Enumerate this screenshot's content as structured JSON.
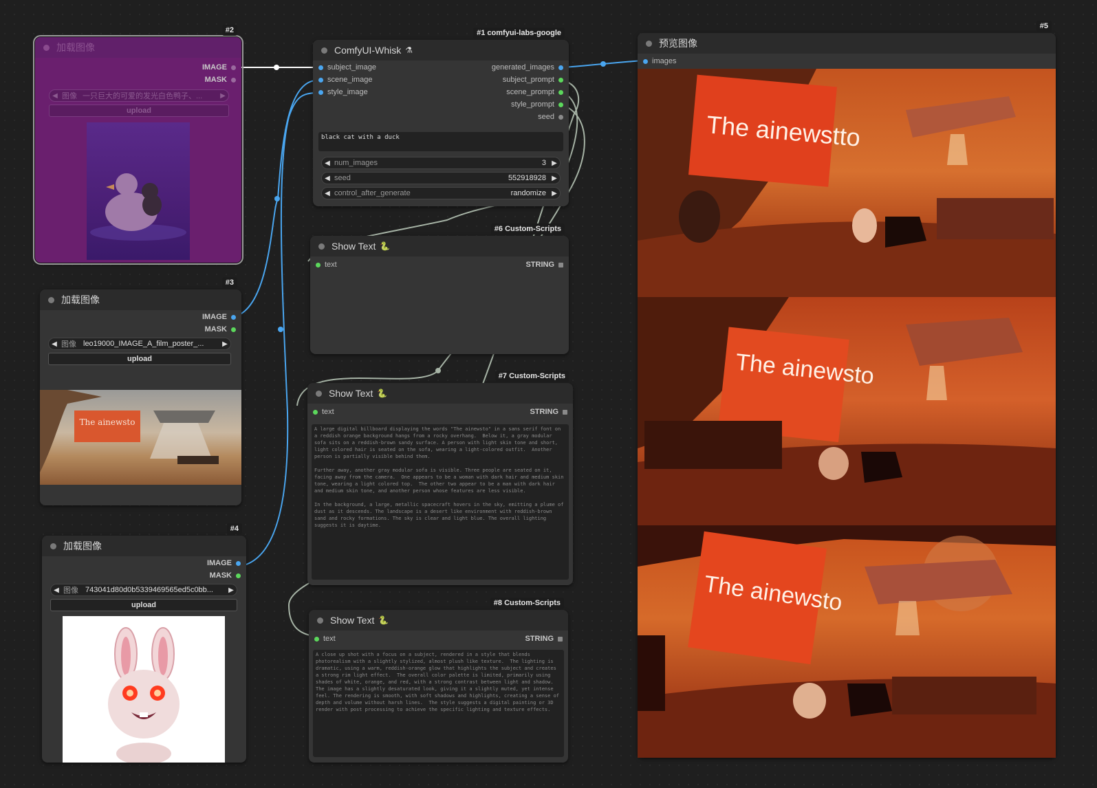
{
  "nodes": {
    "n1": {
      "badge": "#1 comfyui-labs-google",
      "title": "ComfyUI-Whisk",
      "title_icon": "flask-icon",
      "inputs": [
        "subject_image",
        "scene_image",
        "style_image"
      ],
      "outputs": [
        "generated_images",
        "subject_prompt",
        "scene_prompt",
        "style_prompt",
        "seed"
      ],
      "prompt_text": "black cat with a duck",
      "widgets": [
        {
          "label": "num_images",
          "value": "3"
        },
        {
          "label": "seed",
          "value": "552918928"
        },
        {
          "label": "control_after_generate",
          "value": "randomize"
        }
      ]
    },
    "n2": {
      "badge": "#2",
      "title": "加载图像",
      "outputs": [
        "IMAGE",
        "MASK"
      ],
      "image_widget": {
        "label": "图像",
        "value": "一只巨大的可爱的发光白色鸭子、..."
      },
      "upload_label": "upload"
    },
    "n3": {
      "badge": "#3",
      "title": "加载图像",
      "outputs": [
        "IMAGE",
        "MASK"
      ],
      "image_widget": {
        "label": "图像",
        "value": "leo19000_IMAGE_A_film_poster_..."
      },
      "upload_label": "upload",
      "preview_sign_text": "The ainewsto"
    },
    "n4": {
      "badge": "#4",
      "title": "加载图像",
      "outputs": [
        "IMAGE",
        "MASK"
      ],
      "image_widget": {
        "label": "图像",
        "value": "743041d80d0b5339469565ed5c0bb..."
      },
      "upload_label": "upload"
    },
    "n5": {
      "badge": "#5",
      "title": "预览图像",
      "inputs": [
        "images"
      ],
      "billboards": [
        "The ainewstto",
        "The ainewsto",
        "The ainewsto"
      ]
    },
    "n6": {
      "badge": "#6 Custom-Scripts",
      "title": "Show Text",
      "input": "text",
      "output": "STRING",
      "text": ""
    },
    "n7": {
      "badge": "#7 Custom-Scripts",
      "title": "Show Text",
      "input": "text",
      "output": "STRING",
      "text": "A large digital billboard displaying the words \"The ainewsto\" in a sans serif font on a reddish orange background hangs from a rocky overhang.  Below it, a gray modular sofa sits on a reddish-brown sandy surface. A person with light skin tone and short, light colored hair is seated on the sofa, wearing a light-colored outfit.  Another person is partially visible behind them.\n\nFurther away, another gray modular sofa is visible. Three people are seated on it, facing away from the camera.  One appears to be a woman with dark hair and medium skin tone, wearing a light colored top.  The other two appear to be a man with dark hair and medium skin tone, and another person whose features are less visible.\n\nIn the background, a large, metallic spacecraft hovers in the sky, emitting a plume of dust as it descends. The landscape is a desert like environment with reddish-brown sand and rocky formations. The sky is clear and light blue. The overall lighting suggests it is daytime."
    },
    "n8": {
      "badge": "#8 Custom-Scripts",
      "title": "Show Text",
      "input": "text",
      "output": "STRING",
      "text": "A close up shot with a focus on a subject, rendered in a style that blends photorealism with a slightly stylized, almost plush like texture.  The lighting is dramatic, using a warm, reddish-orange glow that highlights the subject and creates a strong rim light effect.  The overall color palette is limited, primarily using shades of white, orange, and red, with a strong contrast between light and shadow. The image has a slightly desaturated look, giving it a slightly muted, yet intense feel. The rendering is smooth, with soft shadows and highlights, creating a sense of depth and volume without harsh lines.  The style suggests a digital painting or 3D render with post processing to achieve the specific lighting and texture effects."
    }
  },
  "colors": {
    "canvas": "#1f1f1f",
    "node_body": "#353535",
    "node_header": "#2b2b2b",
    "bypassed_node": "#6a1f6e",
    "image_link": "#4aa6f0",
    "string_link": "#a7b4a6",
    "string_slot": "#5cd85c"
  }
}
